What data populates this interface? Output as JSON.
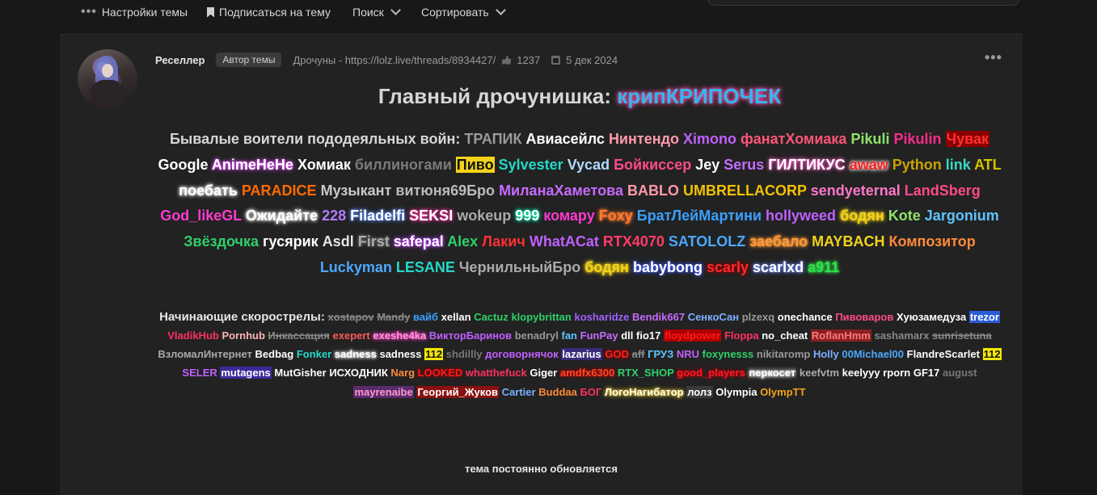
{
  "toolbar": {
    "thread_settings": "Настройки темы",
    "subscribe": "Подписаться на тему",
    "search": "Поиск",
    "sort": "Сортировать"
  },
  "post": {
    "username": "Реселлер",
    "author_badge": "Автор темы",
    "thread_ref": "Дрочуны - https://lolz.live/threads/8934427/",
    "likes": "1237",
    "date": "5 дек 2024",
    "title_prefix": "Главный дрочунишка:",
    "title_name": "крипКРИПОЧЕК",
    "veterans_label": "Бывалые воители пододеяльных войн:",
    "beginners_label": "Начинающие скорострелы:",
    "footer": "тема постоянно обновляется"
  },
  "veterans": [
    {
      "t": "ТРАПИК",
      "c": "#9a9a9a"
    },
    {
      "t": "Авиасейлс",
      "c": "#ffffff"
    },
    {
      "t": "Нинтендо",
      "c": "#ff9aa8"
    },
    {
      "t": "Ximono",
      "c": "#c060ff"
    },
    {
      "t": "фанатХомиака",
      "c": "#ff5577"
    },
    {
      "t": "Pikuli",
      "c": "#8fe36b"
    },
    {
      "t": "Pikulin",
      "c": "#ff2a8a"
    },
    {
      "t": "Чувак",
      "c": "#ff3030",
      "bg": "#8a0000"
    },
    {
      "t": "Google",
      "c": "#ffffff"
    },
    {
      "t": "AnimeHeHe",
      "c": "#ffffff",
      "glow": "#e04cff"
    },
    {
      "t": "Хомиак",
      "c": "#ffffff"
    },
    {
      "t": "биллиногами",
      "c": "#7b7b7b"
    },
    {
      "t": "Пиво",
      "c": "#111111",
      "bg": "#f3d31a"
    },
    {
      "t": "Sylvester",
      "c": "#25d8c8"
    },
    {
      "t": "Vycad",
      "c": "#b0d8ff"
    },
    {
      "t": "Бойкиссер",
      "c": "#ff4a8a"
    },
    {
      "t": "Jey",
      "c": "#ffffff"
    },
    {
      "t": "Serus",
      "c": "#c66bff"
    },
    {
      "t": "ГИЛТИКУС",
      "c": "#ffffff",
      "glow": "#ff5ec8"
    },
    {
      "t": "awaw",
      "c": "#ff2020",
      "glow": "#ffffff"
    },
    {
      "t": "Python",
      "c": "#c9a300"
    },
    {
      "t": "link",
      "c": "#3ad8c8"
    },
    {
      "t": "ATL",
      "c": "#d3c200"
    },
    {
      "t": "поебать",
      "c": "#ffffff",
      "glow": "#ffffff"
    },
    {
      "t": "PARADICE",
      "c": "#ff6a00"
    },
    {
      "t": "Музыкант",
      "c": "#c8c8c8"
    },
    {
      "t": "витюня69Бро",
      "c": "#bbbbbb"
    },
    {
      "t": "МиланаХаметова",
      "c": "#c66bff"
    },
    {
      "t": "BABLO",
      "c": "#ff9aa8"
    },
    {
      "t": "UMBRELLACORP",
      "c": "#f2c200"
    },
    {
      "t": "sendyeternal",
      "c": "#ff77c8"
    },
    {
      "t": "LandSberg",
      "c": "#ff4a8a"
    },
    {
      "t": "God_likeGL",
      "c": "#ff3bd0"
    },
    {
      "t": "Ожидайте",
      "c": "#ffffff",
      "glow": "#ffffff"
    },
    {
      "t": "228",
      "c": "#b07dff"
    },
    {
      "t": "Filadelfi",
      "c": "#ffffff",
      "glow": "#5a8bff"
    },
    {
      "t": "SEKSI",
      "c": "#ffffff",
      "glow": "#ff2fa0"
    },
    {
      "t": "wokeup",
      "c": "#aaaaaa"
    },
    {
      "t": "999",
      "c": "#ffffff",
      "glow": "#00ffc0"
    },
    {
      "t": "комару",
      "c": "#ff3bd0"
    },
    {
      "t": "Foxy",
      "c": "#ff7a30",
      "glow": "#ff7a30"
    },
    {
      "t": "БратЛейМартини",
      "c": "#3aa0ff"
    },
    {
      "t": "hollyweed",
      "c": "#c060ff"
    },
    {
      "t": "бодян",
      "c": "#ffffff",
      "glow": "#f3d31a",
      "fg": "#f3d31a"
    },
    {
      "t": "Kote",
      "c": "#8fe36b"
    },
    {
      "t": "Jargonium",
      "c": "#5fc4ff"
    },
    {
      "t": "Звёздочка",
      "c": "#2fd06a"
    },
    {
      "t": "гусярик",
      "c": "#ffffff"
    },
    {
      "t": "Asdl",
      "c": "#e6e6e6"
    },
    {
      "t": "First",
      "c": "#aaaaaa",
      "glow": "#666666"
    },
    {
      "t": "safepal",
      "c": "#ffffff",
      "glow": "#c040ff"
    },
    {
      "t": "Alex",
      "c": "#2fd06a"
    },
    {
      "t": "Лакич",
      "c": "#ff3030"
    },
    {
      "t": "WhatACat",
      "c": "#c060ff"
    },
    {
      "t": "RTX4070",
      "c": "#ff3b6b"
    },
    {
      "t": "SATOLOLZ",
      "c": "#4aa8ff"
    },
    {
      "t": "заебало",
      "c": "#ff9a3a",
      "glow": "#ff9a3a"
    },
    {
      "t": "MAYBACH",
      "c": "#f3d31a"
    },
    {
      "t": "Композитор",
      "c": "#ff8a3a"
    },
    {
      "t": "Luckyman",
      "c": "#4aa8ff"
    },
    {
      "t": "LESANE",
      "c": "#25d8c8"
    },
    {
      "t": "ЧернильныйБро",
      "c": "#aaaaaa"
    },
    {
      "t": "бодян",
      "c": "#f3d31a",
      "glow": "#f3d31a"
    },
    {
      "t": "babybong",
      "c": "#ffffff",
      "glow": "#3a5bff"
    },
    {
      "t": "scarly",
      "c": "#ff2a2a",
      "glow": "#880000"
    },
    {
      "t": "scarlxd",
      "c": "#ffffff",
      "glow": "#6a8bff"
    },
    {
      "t": "a911",
      "c": "#2fe04a",
      "glow": "#2fe04a"
    }
  ],
  "beginners": [
    {
      "t": "xostapov",
      "c": "#888888",
      "s": true
    },
    {
      "t": "Mandy",
      "c": "#888888",
      "s": true
    },
    {
      "t": "вайб",
      "c": "#3aa0ff"
    },
    {
      "t": "xellan",
      "c": "#ffffff"
    },
    {
      "t": "Cactuz",
      "c": "#2fd06a"
    },
    {
      "t": "klopybrittan",
      "c": "#2fd06a"
    },
    {
      "t": "kosharidze",
      "c": "#a060ff"
    },
    {
      "t": "Bendik667",
      "c": "#c66bff"
    },
    {
      "t": "СенкоСан",
      "c": "#7ab0ff"
    },
    {
      "t": "plzexq",
      "c": "#999999"
    },
    {
      "t": "onechance",
      "c": "#ffffff"
    },
    {
      "t": "Пивоваров",
      "c": "#ff4a8a"
    },
    {
      "t": "Хуюзамедуза",
      "c": "#ffffff"
    },
    {
      "t": "trezor",
      "c": "#ffffff",
      "bg": "#2a5bd8"
    },
    {
      "t": "VladikHub",
      "c": "#ff3060"
    },
    {
      "t": "Pornhub",
      "c": "#ffb0b8"
    },
    {
      "t": "Инкассация",
      "c": "#888888",
      "s": true
    },
    {
      "t": "exepert",
      "c": "#ff5a5a"
    },
    {
      "t": "exeshe4ka",
      "c": "#ff9ad0",
      "glow": "#ff3bd0"
    },
    {
      "t": "ВикторБаринов",
      "c": "#c060ff"
    },
    {
      "t": "benadryl",
      "c": "#999999"
    },
    {
      "t": "fan",
      "c": "#5fc4ff"
    },
    {
      "t": "FunPay",
      "c": "#c66bff"
    },
    {
      "t": "dll",
      "c": "#ffffff"
    },
    {
      "t": "fio17",
      "c": "#ffffff"
    },
    {
      "t": "floydpower",
      "c": "#ff1a1a",
      "bg": "#b00000"
    },
    {
      "t": "Floppa",
      "c": "#ff3060"
    },
    {
      "t": "no_cheat",
      "c": "#ffffff"
    },
    {
      "t": "RoflanHmm",
      "c": "#ff7a7a",
      "bg": "#8a2020"
    },
    {
      "t": "sashamarx",
      "c": "#888888"
    },
    {
      "t": "sunrisetuna",
      "c": "#888888",
      "s": true
    },
    {
      "t": "ВзломалИнтернет",
      "c": "#aaaaaa"
    },
    {
      "t": "Bedbag",
      "c": "#ffffff"
    },
    {
      "t": "Fonker",
      "c": "#25d8c8"
    },
    {
      "t": "sadness",
      "c": "#ffffff",
      "glow": "#ffffff"
    },
    {
      "t": "sadness",
      "c": "#ffffff"
    },
    {
      "t": "112",
      "c": "#111111",
      "bg": "#f3e800"
    },
    {
      "t": "shdillly",
      "c": "#777777"
    },
    {
      "t": "договорнячок",
      "c": "#c060ff"
    },
    {
      "t": "lazarius",
      "c": "#ffffff",
      "bg": "#3a2a7a"
    },
    {
      "t": "GOD",
      "c": "#ff2020",
      "glow": "#880000"
    },
    {
      "t": "aff",
      "c": "#888888",
      "s": true
    },
    {
      "t": "ГРУЗ",
      "c": "#5fc4ff"
    },
    {
      "t": "NRU",
      "c": "#c060ff"
    },
    {
      "t": "foxynesss",
      "c": "#2fd06a"
    },
    {
      "t": "nikitaromp",
      "c": "#999999"
    },
    {
      "t": "Holly",
      "c": "#7ab0ff"
    },
    {
      "t": "00Michael00",
      "c": "#4aa8ff"
    },
    {
      "t": "FlandreScarlet",
      "c": "#ffffff"
    },
    {
      "t": "112",
      "c": "#111111",
      "bg": "#f3e800"
    },
    {
      "t": "SELER",
      "c": "#c060ff"
    },
    {
      "t": "mutagens",
      "c": "#ffffff",
      "bg": "#3a2a9a"
    },
    {
      "t": "MutGisher",
      "c": "#ffffff"
    },
    {
      "t": "ИСХОДНИК",
      "c": "#ffffff"
    },
    {
      "t": "Narg",
      "c": "#ff8a3a"
    },
    {
      "t": "LOOKED",
      "c": "#ff1a1a",
      "glow": "#880000"
    },
    {
      "t": "whatthefuck",
      "c": "#ff3060"
    },
    {
      "t": "Giger",
      "c": "#ffffff"
    },
    {
      "t": "amdfx6300",
      "c": "#ff4a2a",
      "glow": "#aa0000"
    },
    {
      "t": "RTX_SHOP",
      "c": "#2fd06a"
    },
    {
      "t": "good_players",
      "c": "#ff1a2a",
      "glow": "#aa0000"
    },
    {
      "t": "перкосет",
      "c": "#ffffff",
      "bg": "#2a2a2a",
      "glow": "#ffffff"
    },
    {
      "t": "keefvtm",
      "c": "#aaaaaa"
    },
    {
      "t": "keelyyy",
      "c": "#ffffff"
    },
    {
      "t": "rporn",
      "c": "#ffffff"
    },
    {
      "t": "GF17",
      "c": "#ffffff"
    },
    {
      "t": "august",
      "c": "#777777"
    },
    {
      "t": "mayrenaibe",
      "c": "#ff9ad0",
      "bg": "#5a2a6a"
    },
    {
      "t": "Георгий_Жуков",
      "c": "#ffffff",
      "bg": "#8a1010"
    },
    {
      "t": "Cartier",
      "c": "#7ab0ff"
    },
    {
      "t": "Buddaa",
      "c": "#ff8a3a"
    },
    {
      "t": "БОГ",
      "c": "#ff3060"
    },
    {
      "t": "ЛогоНагибатор",
      "c": "#ffffff",
      "glow": "#f3d31a"
    },
    {
      "t": "лолз",
      "c": "#ffffff",
      "bg": "#3a3a3a"
    },
    {
      "t": "Olympia",
      "c": "#ffffff"
    },
    {
      "t": "OlympTT",
      "c": "#f3a21a"
    }
  ]
}
